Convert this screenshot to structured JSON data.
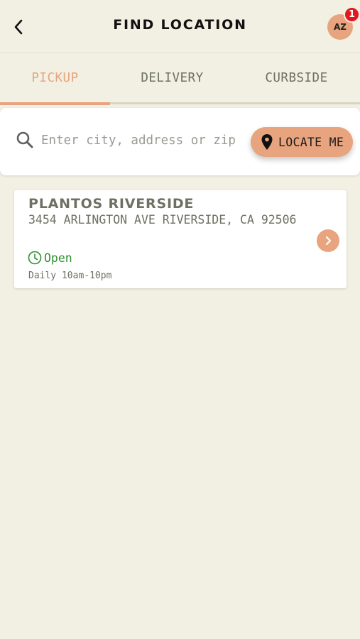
{
  "header": {
    "title": "FIND LOCATION",
    "avatar_initials": "AZ",
    "notification_count": "1"
  },
  "tabs": [
    {
      "label": "PICKUP",
      "active": true
    },
    {
      "label": "DELIVERY",
      "active": false
    },
    {
      "label": "CURBSIDE",
      "active": false
    }
  ],
  "search": {
    "value": "",
    "placeholder": "Enter city, address or zip",
    "locate_label": "LOCATE ME"
  },
  "locations": [
    {
      "name": "PLANTOS RIVERSIDE",
      "address": "3454 ARLINGTON AVE RIVERSIDE, CA 92506",
      "status": "Open",
      "hours": "Daily 10am-10pm"
    }
  ],
  "colors": {
    "background": "#f2efe3",
    "accent": "#e8a47e",
    "text_muted": "#6d7062",
    "open_green": "#2f8f2f",
    "badge_red": "#e2171f"
  },
  "icons": {
    "back": "chevron-left-icon",
    "search": "search-icon",
    "locate": "location-pin-icon",
    "status": "clock-icon",
    "card_action": "chevron-right-icon"
  }
}
